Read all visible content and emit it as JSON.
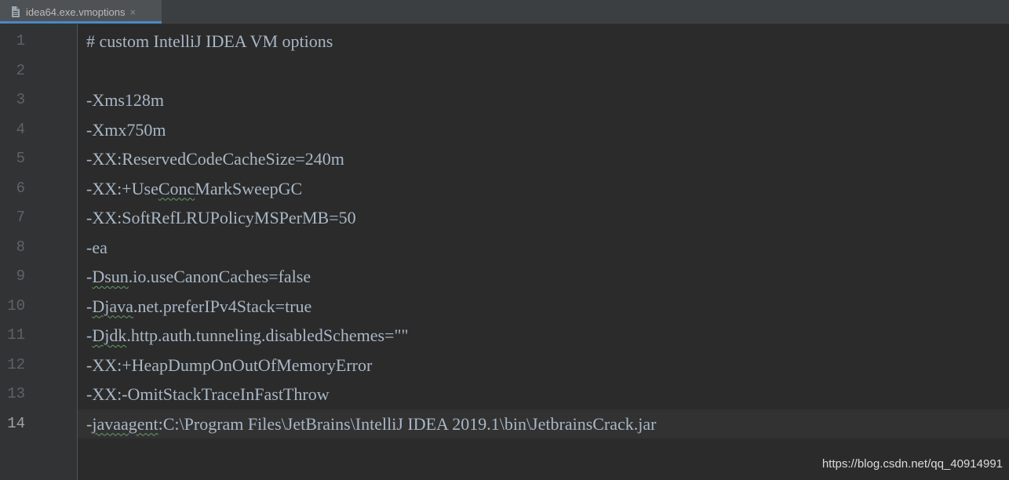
{
  "tab": {
    "filename": "idea64.exe.vmoptions",
    "close_glyph": "×",
    "icon": "file-icon"
  },
  "editor": {
    "active_line": 14,
    "lines": [
      {
        "num": "1",
        "text": "# custom IntelliJ IDEA VM options"
      },
      {
        "num": "2",
        "text": ""
      },
      {
        "num": "3",
        "text": "-Xms128m"
      },
      {
        "num": "4",
        "text": "-Xmx750m"
      },
      {
        "num": "5",
        "text": "-XX:ReservedCodeCacheSize=240m"
      },
      {
        "num": "6",
        "text": "-XX:+UseConcMarkSweepGC"
      },
      {
        "num": "7",
        "text": "-XX:SoftRefLRUPolicyMSPerMB=50"
      },
      {
        "num": "8",
        "text": "-ea"
      },
      {
        "num": "9",
        "text": "-Dsun.io.useCanonCaches=false"
      },
      {
        "num": "10",
        "text": "-Djava.net.preferIPv4Stack=true"
      },
      {
        "num": "11",
        "text": "-Djdk.http.auth.tunneling.disabledSchemes=\"\""
      },
      {
        "num": "12",
        "text": "-XX:+HeapDumpOnOutOfMemoryError"
      },
      {
        "num": "13",
        "text": "-XX:-OmitStackTraceInFastThrow"
      },
      {
        "num": "14",
        "text": "-javaagent:C:\\Program Files\\JetBrains\\IntelliJ IDEA 2019.1\\bin\\JetbrainsCrack.jar"
      }
    ]
  },
  "watermark": "https://blog.csdn.net/qq_40914991",
  "colors": {
    "background": "#2b2b2b",
    "gutter": "#313335",
    "text": "#a9b7c6",
    "line_number": "#606366",
    "tab_accent": "#4a88c7"
  }
}
